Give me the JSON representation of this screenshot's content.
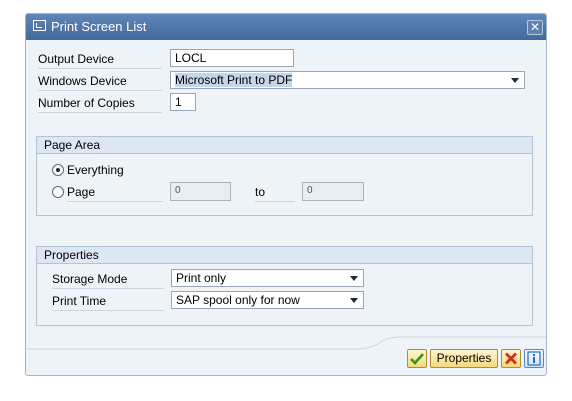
{
  "dialog": {
    "title": "Print Screen List"
  },
  "form": {
    "output_device_label": "Output Device",
    "output_device_value": "LOCL",
    "windows_device_label": "Windows Device",
    "windows_device_value": "Microsoft Print to PDF",
    "copies_label": "Number of Copies",
    "copies_value": "1"
  },
  "page_area": {
    "title": "Page Area",
    "everything_label": "Everything",
    "page_label": "Page",
    "from_value": "0",
    "to_label": "to",
    "to_value": "0",
    "selected": "Everything"
  },
  "properties": {
    "title": "Properties",
    "storage_mode_label": "Storage Mode",
    "storage_mode_value": "Print only",
    "print_time_label": "Print Time",
    "print_time_value": "SAP spool only for now"
  },
  "buttons": {
    "properties_label": "Properties"
  },
  "icons": {
    "close": "close-icon",
    "ok": "check-icon",
    "cancel": "cancel-icon",
    "info": "info-icon",
    "dropdown": "chevron-down-icon"
  },
  "colors": {
    "titlebar": "#4f76a9",
    "dialog_bg": "#eef3f8",
    "group_header": "#dce7f3",
    "button": "#f5d879",
    "ok_green": "#2f9a1a",
    "cancel_red": "#d52b1e",
    "info_blue": "#1b6fc2"
  }
}
